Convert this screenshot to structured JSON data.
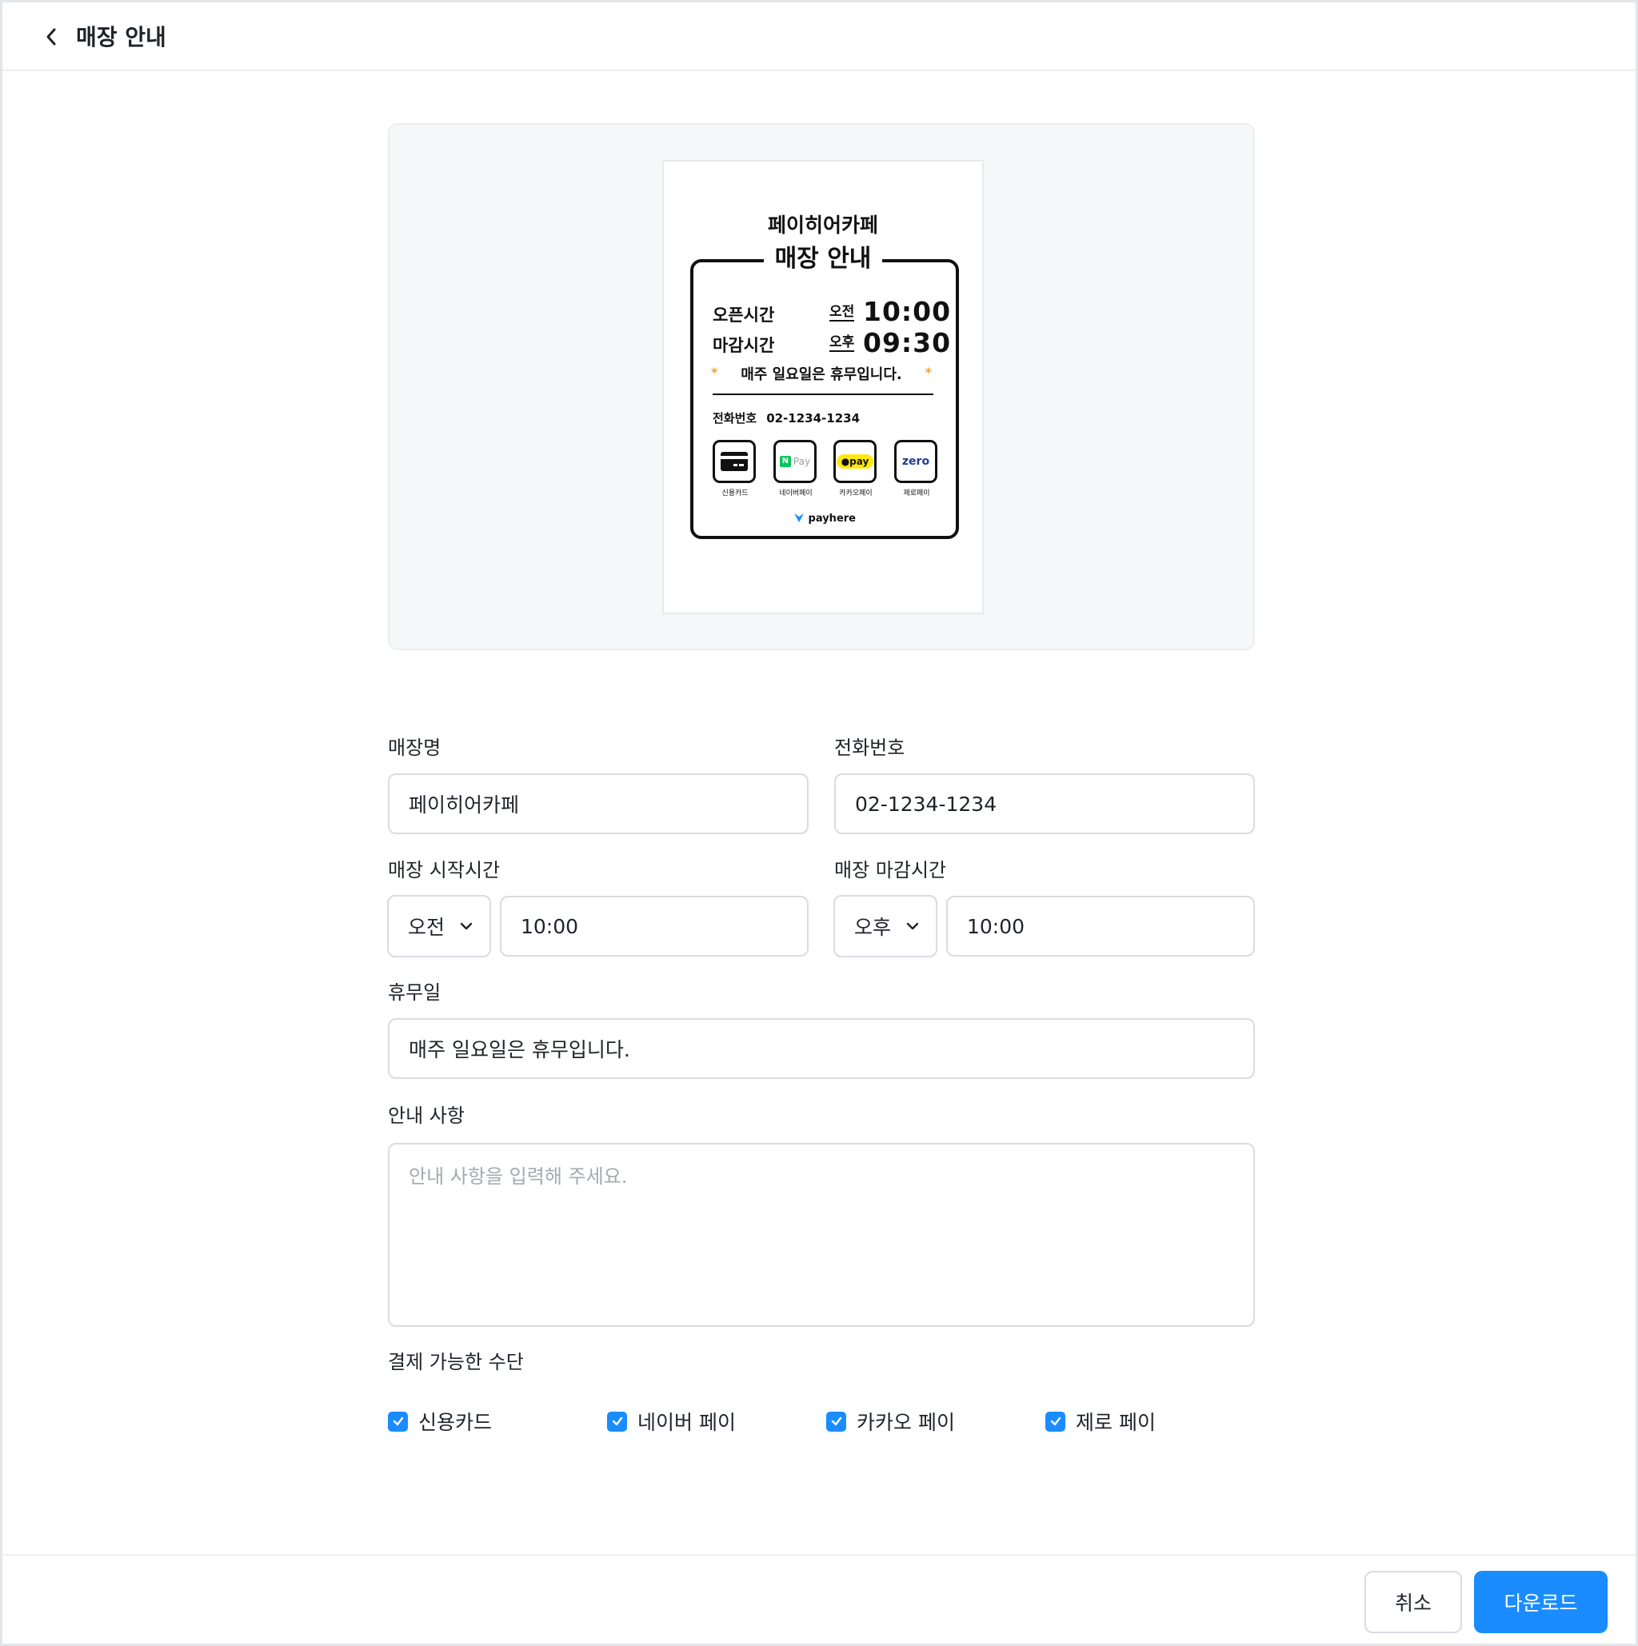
{
  "header": {
    "title": "매장 안내"
  },
  "preview": {
    "store_name": "페이히어카페",
    "heading": "매장 안내",
    "open_label": "오픈시간",
    "open_ampm": "오전",
    "open_time": "10:00",
    "close_label": "마감시간",
    "close_ampm": "오후",
    "close_time": "09:30",
    "holiday": "매주 일요일은 휴무입니다.",
    "star": "*",
    "phone_label": "전화번호",
    "phone": "02-1234-1234",
    "payments": [
      {
        "caption": "신용카드",
        "icon": "credit-card-icon"
      },
      {
        "caption": "네이버페이",
        "icon": "naver-pay-icon",
        "logo_text": "Pay"
      },
      {
        "caption": "카카오페이",
        "icon": "kakao-pay-icon",
        "logo_text": "pay"
      },
      {
        "caption": "제로페이",
        "icon": "zero-pay-icon",
        "logo_text": "zero"
      }
    ],
    "brand": "payhere",
    "colors": {
      "star": "#f0a52a",
      "naver": "#03c75a",
      "kakao": "#ffe812",
      "zero": "#1f3a93",
      "brand": "#1a8cff"
    }
  },
  "form": {
    "store_name": {
      "label": "매장명",
      "value": "페이히어카페"
    },
    "phone": {
      "label": "전화번호",
      "value": "02-1234-1234"
    },
    "start": {
      "label": "매장 시작시간",
      "ampm": "오전",
      "time": "10:00"
    },
    "end": {
      "label": "매장 마감시간",
      "ampm": "오후",
      "time": "10:00"
    },
    "holiday": {
      "label": "휴무일",
      "value": "매주 일요일은 휴무입니다."
    },
    "notice": {
      "label": "안내 사항",
      "placeholder": "안내 사항을 입력해 주세요."
    },
    "payments": {
      "label": "결제 가능한 수단",
      "options": [
        {
          "label": "신용카드",
          "checked": true
        },
        {
          "label": "네이버 페이",
          "checked": true
        },
        {
          "label": "카카오 페이",
          "checked": true
        },
        {
          "label": "제로 페이",
          "checked": true
        }
      ]
    }
  },
  "footer": {
    "cancel": "취소",
    "download": "다운로드"
  },
  "colors": {
    "accent": "#1a8cff",
    "border": "#d9dce0",
    "preview_bg": "#f6f7f9"
  }
}
